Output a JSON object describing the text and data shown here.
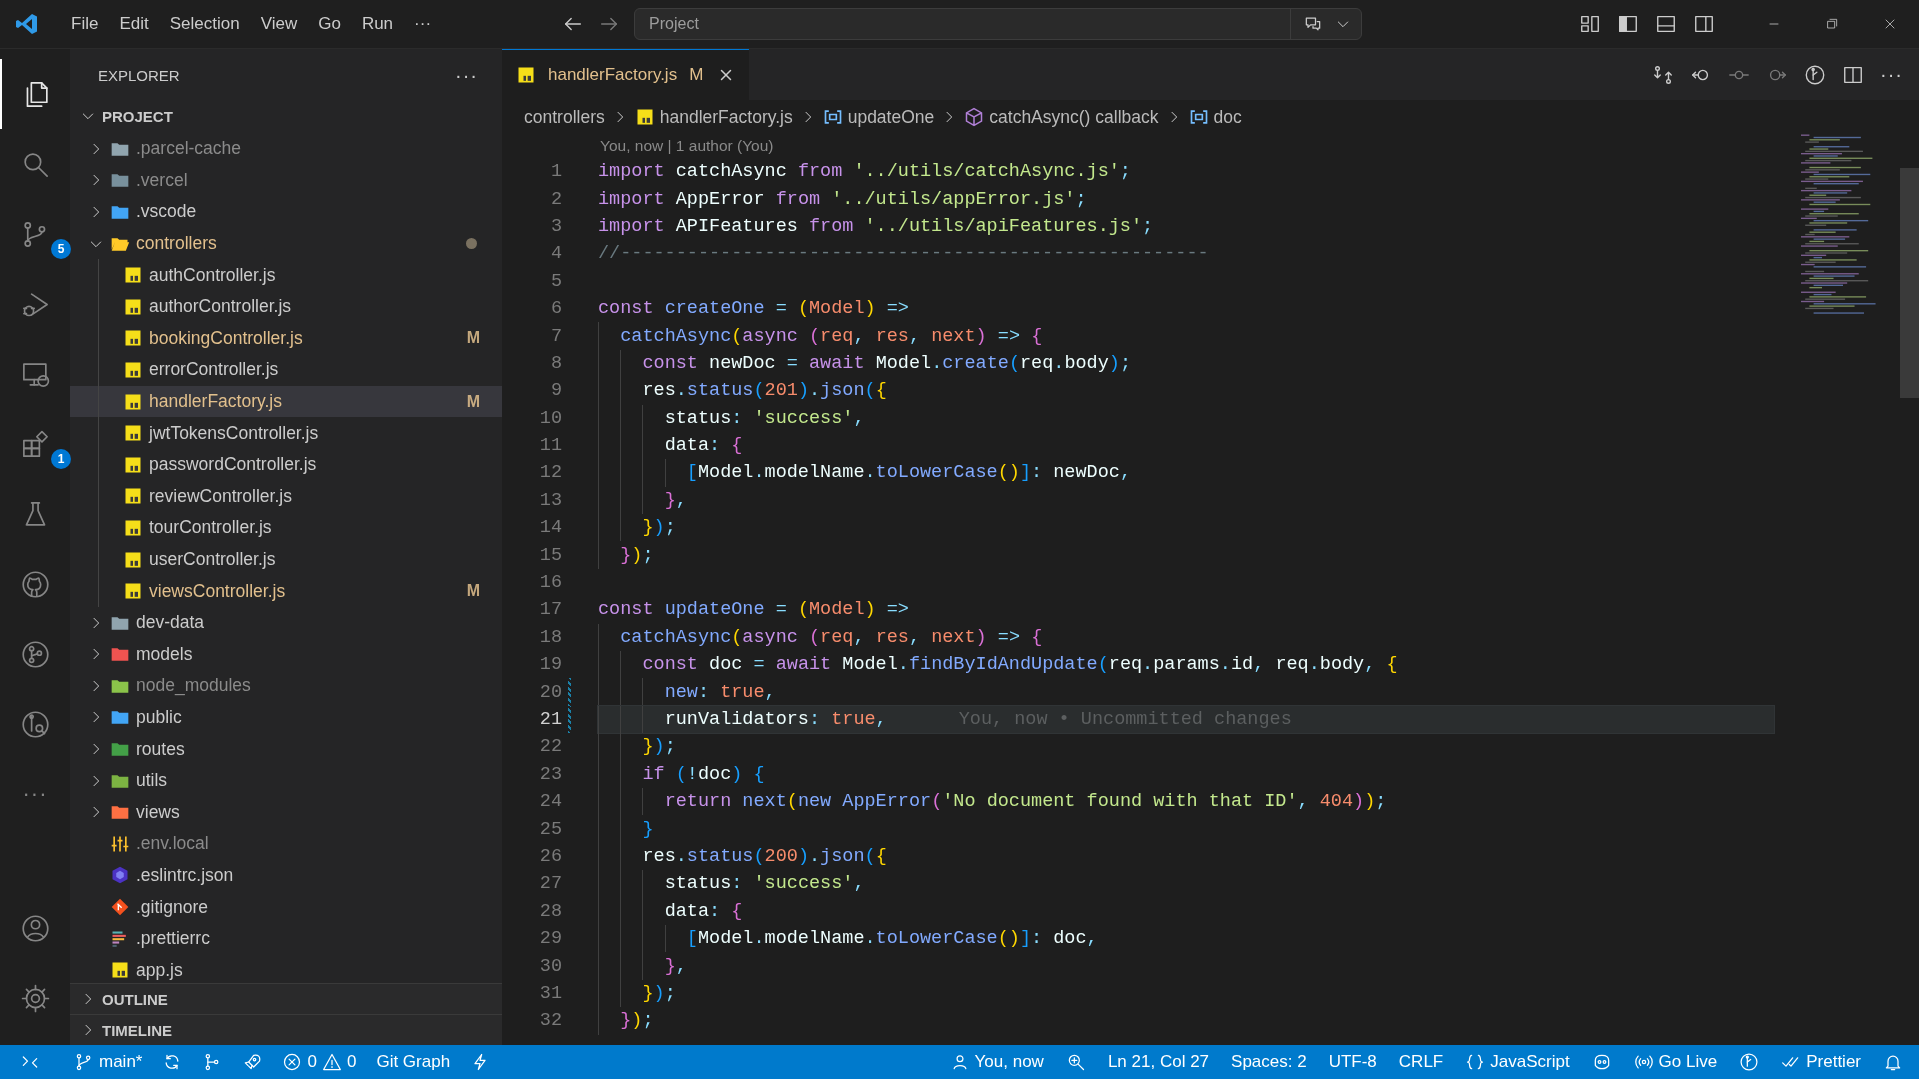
{
  "title_bar": {
    "menu": [
      "File",
      "Edit",
      "Selection",
      "View",
      "Go",
      "Run",
      "···"
    ],
    "command_center": {
      "label": "Project"
    }
  },
  "activity_bar": {
    "items": [
      {
        "kind": "files",
        "selected": true
      },
      {
        "kind": "search",
        "selected": false
      },
      {
        "kind": "scm",
        "selected": false,
        "badge": "5"
      },
      {
        "kind": "debug",
        "selected": false
      },
      {
        "kind": "remote",
        "selected": false
      },
      {
        "kind": "extensions",
        "selected": false,
        "badge": "1"
      },
      {
        "kind": "testing",
        "selected": false
      },
      {
        "kind": "github",
        "selected": false
      },
      {
        "kind": "gitgraph",
        "selected": false
      },
      {
        "kind": "inspect",
        "selected": false
      },
      {
        "kind": "more",
        "selected": false,
        "label": "···"
      }
    ],
    "bottom": [
      {
        "kind": "account"
      },
      {
        "kind": "settings"
      }
    ]
  },
  "explorer": {
    "title": "EXPLORER",
    "more": "···",
    "section": {
      "title": "PROJECT",
      "expanded": true
    },
    "tree": [
      {
        "name": ".parcel-cache",
        "kind": "folder",
        "color": "#90a4ae",
        "expanded": false,
        "dimmed": true,
        "modified": false,
        "selected": false
      },
      {
        "name": ".vercel",
        "kind": "folder",
        "color": "#78909c",
        "expanded": false,
        "dimmed": true,
        "modified": false,
        "selected": false
      },
      {
        "name": ".vscode",
        "kind": "folder",
        "color": "#42a5f5",
        "expanded": false,
        "dimmed": false,
        "modified": false,
        "selected": false
      },
      {
        "name": "controllers",
        "kind": "folder",
        "color": "#ffca28",
        "expanded": true,
        "dimmed": false,
        "modified": true,
        "selected": false,
        "children": [
          {
            "name": "authController.js",
            "kind": "js",
            "dimmed": false,
            "modified": false,
            "selected": false
          },
          {
            "name": "authorController.js",
            "kind": "js",
            "dimmed": false,
            "modified": false,
            "selected": false
          },
          {
            "name": "bookingController.js",
            "kind": "js",
            "dimmed": false,
            "modified": true,
            "selected": false,
            "status": "M"
          },
          {
            "name": "errorController.js",
            "kind": "js",
            "dimmed": false,
            "modified": false,
            "selected": false
          },
          {
            "name": "handlerFactory.js",
            "kind": "js",
            "dimmed": false,
            "modified": true,
            "selected": true,
            "status": "M"
          },
          {
            "name": "jwtTokensController.js",
            "kind": "js",
            "dimmed": false,
            "modified": false,
            "selected": false
          },
          {
            "name": "passwordController.js",
            "kind": "js",
            "dimmed": false,
            "modified": false,
            "selected": false
          },
          {
            "name": "reviewController.js",
            "kind": "js",
            "dimmed": false,
            "modified": false,
            "selected": false
          },
          {
            "name": "tourController.js",
            "kind": "js",
            "dimmed": false,
            "modified": false,
            "selected": false
          },
          {
            "name": "userController.js",
            "kind": "js",
            "dimmed": false,
            "modified": false,
            "selected": false
          },
          {
            "name": "viewsController.js",
            "kind": "js",
            "dimmed": false,
            "modified": true,
            "selected": false,
            "status": "M"
          }
        ]
      },
      {
        "name": "dev-data",
        "kind": "folder",
        "color": "#90a4ae",
        "expanded": false,
        "dimmed": false,
        "modified": false,
        "selected": false
      },
      {
        "name": "models",
        "kind": "folder",
        "color": "#ef5350",
        "expanded": false,
        "dimmed": false,
        "modified": false,
        "selected": false
      },
      {
        "name": "node_modules",
        "kind": "folder",
        "color": "#8bc34a",
        "expanded": false,
        "dimmed": true,
        "modified": false,
        "selected": false
      },
      {
        "name": "public",
        "kind": "folder",
        "color": "#42a5f5",
        "expanded": false,
        "dimmed": false,
        "modified": false,
        "selected": false
      },
      {
        "name": "routes",
        "kind": "folder",
        "color": "#43a047",
        "expanded": false,
        "dimmed": false,
        "modified": false,
        "selected": false
      },
      {
        "name": "utils",
        "kind": "folder",
        "color": "#7cb342",
        "expanded": false,
        "dimmed": false,
        "modified": false,
        "selected": false
      },
      {
        "name": "views",
        "kind": "folder",
        "color": "#ff7043",
        "expanded": false,
        "dimmed": false,
        "modified": false,
        "selected": false
      },
      {
        "name": ".env.local",
        "kind": "env",
        "dimmed": true,
        "modified": false,
        "selected": false
      },
      {
        "name": ".eslintrc.json",
        "kind": "eslint",
        "dimmed": false,
        "modified": false,
        "selected": false
      },
      {
        "name": ".gitignore",
        "kind": "git",
        "dimmed": false,
        "modified": false,
        "selected": false
      },
      {
        "name": ".prettierrc",
        "kind": "prettier",
        "dimmed": false,
        "modified": false,
        "selected": false
      },
      {
        "name": "app.js",
        "kind": "js",
        "dimmed": false,
        "modified": false,
        "selected": false
      }
    ],
    "panels": [
      {
        "title": "OUTLINE",
        "expanded": false
      },
      {
        "title": "TIMELINE",
        "expanded": false
      }
    ]
  },
  "editor": {
    "tabs": [
      {
        "label": "handlerFactory.js",
        "status": "M",
        "kind": "js",
        "selected": true
      }
    ],
    "more": "···",
    "breadcrumbs": [
      {
        "text": "controllers",
        "kind": "folder"
      },
      {
        "text": "handlerFactory.js",
        "kind": "js"
      },
      {
        "text": "updateOne",
        "kind": "variable"
      },
      {
        "text": "catchAsync() callback",
        "kind": "method"
      },
      {
        "text": "doc",
        "kind": "variable"
      }
    ],
    "blame_header": "You, now | 1 author (You)",
    "lines": [
      {
        "n": "1",
        "modified": false,
        "current": false,
        "text": "import catchAsync from '../utils/catchAsync.js';"
      },
      {
        "n": "2",
        "modified": false,
        "current": false,
        "text": "import AppError from '../utils/appError.js';"
      },
      {
        "n": "3",
        "modified": false,
        "current": false,
        "text": "import APIFeatures from '../utils/apiFeatures.js';"
      },
      {
        "n": "4",
        "modified": false,
        "current": false,
        "text": "//-----------------------------------------------------"
      },
      {
        "n": "5",
        "modified": false,
        "current": false
      },
      {
        "n": "6",
        "modified": false,
        "current": false,
        "text": "const createOne = (Model) =>"
      },
      {
        "n": "7",
        "modified": false,
        "current": false,
        "text": "  catchAsync(async (req, res, next) => {"
      },
      {
        "n": "8",
        "modified": false,
        "current": false,
        "text": "    const newDoc = await Model.create(req.body);"
      },
      {
        "n": "9",
        "modified": false,
        "current": false,
        "text": "    res.status(201).json({"
      },
      {
        "n": "10",
        "modified": false,
        "current": false,
        "text": "      status: 'success',"
      },
      {
        "n": "11",
        "modified": false,
        "current": false,
        "text": "      data: {"
      },
      {
        "n": "12",
        "modified": false,
        "current": false,
        "text": "        [Model.modelName.toLowerCase()]: newDoc,"
      },
      {
        "n": "13",
        "modified": false,
        "current": false,
        "text": "      },"
      },
      {
        "n": "14",
        "modified": false,
        "current": false,
        "text": "    });"
      },
      {
        "n": "15",
        "modified": false,
        "current": false,
        "text": "  });"
      },
      {
        "n": "16",
        "modified": false,
        "current": false
      },
      {
        "n": "17",
        "modified": false,
        "current": false,
        "text": "const updateOne = (Model) =>"
      },
      {
        "n": "18",
        "modified": false,
        "current": false,
        "text": "  catchAsync(async (req, res, next) => {"
      },
      {
        "n": "19",
        "modified": false,
        "current": false,
        "text": "    const doc = await Model.findByIdAndUpdate(req.params.id, req.body, {"
      },
      {
        "n": "20",
        "modified": true,
        "current": false,
        "text": "      new: true,"
      },
      {
        "n": "21",
        "modified": true,
        "current": true,
        "text": "      runValidators: true,",
        "blame": "You, now • Uncommitted changes"
      },
      {
        "n": "22",
        "modified": false,
        "current": false,
        "text": "    });"
      },
      {
        "n": "23",
        "modified": false,
        "current": false,
        "text": "    if (!doc) {"
      },
      {
        "n": "24",
        "modified": false,
        "current": false,
        "text": "      return next(new AppError('No document found with that ID', 404));"
      },
      {
        "n": "25",
        "modified": false,
        "current": false,
        "text": "    }"
      },
      {
        "n": "26",
        "modified": false,
        "current": false,
        "text": "    res.status(200).json({"
      },
      {
        "n": "27",
        "modified": false,
        "current": false,
        "text": "      status: 'success',"
      },
      {
        "n": "28",
        "modified": false,
        "current": false,
        "text": "      data: {"
      },
      {
        "n": "29",
        "modified": false,
        "current": false,
        "text": "        [Model.modelName.toLowerCase()]: doc,"
      },
      {
        "n": "30",
        "modified": false,
        "current": false,
        "text": "      },"
      },
      {
        "n": "31",
        "modified": false,
        "current": false,
        "text": "    });"
      },
      {
        "n": "32",
        "modified": false,
        "current": false,
        "text": "  });"
      }
    ]
  },
  "status_bar": {
    "left": [
      {
        "kind": "remote"
      },
      {
        "kind": "branch",
        "label": "main*"
      },
      {
        "kind": "sync"
      },
      {
        "kind": "graph"
      },
      {
        "kind": "rocket"
      },
      {
        "kind": "problems",
        "errors": "0",
        "warnings": "0"
      },
      {
        "kind": "text",
        "label": "Git Graph"
      },
      {
        "kind": "bolt"
      }
    ],
    "right": [
      {
        "kind": "blame",
        "label": "You, now"
      },
      {
        "kind": "zoom"
      },
      {
        "kind": "text",
        "label": "Ln 21, Col 27"
      },
      {
        "kind": "text",
        "label": "Spaces: 2"
      },
      {
        "kind": "text",
        "label": "UTF-8"
      },
      {
        "kind": "text",
        "label": "CRLF"
      },
      {
        "kind": "language",
        "label": "JavaScript"
      },
      {
        "kind": "copilot"
      },
      {
        "kind": "golive",
        "label": "Go Live"
      },
      {
        "kind": "gitlens"
      },
      {
        "kind": "prettier",
        "label": "Prettier"
      },
      {
        "kind": "bell"
      }
    ]
  }
}
